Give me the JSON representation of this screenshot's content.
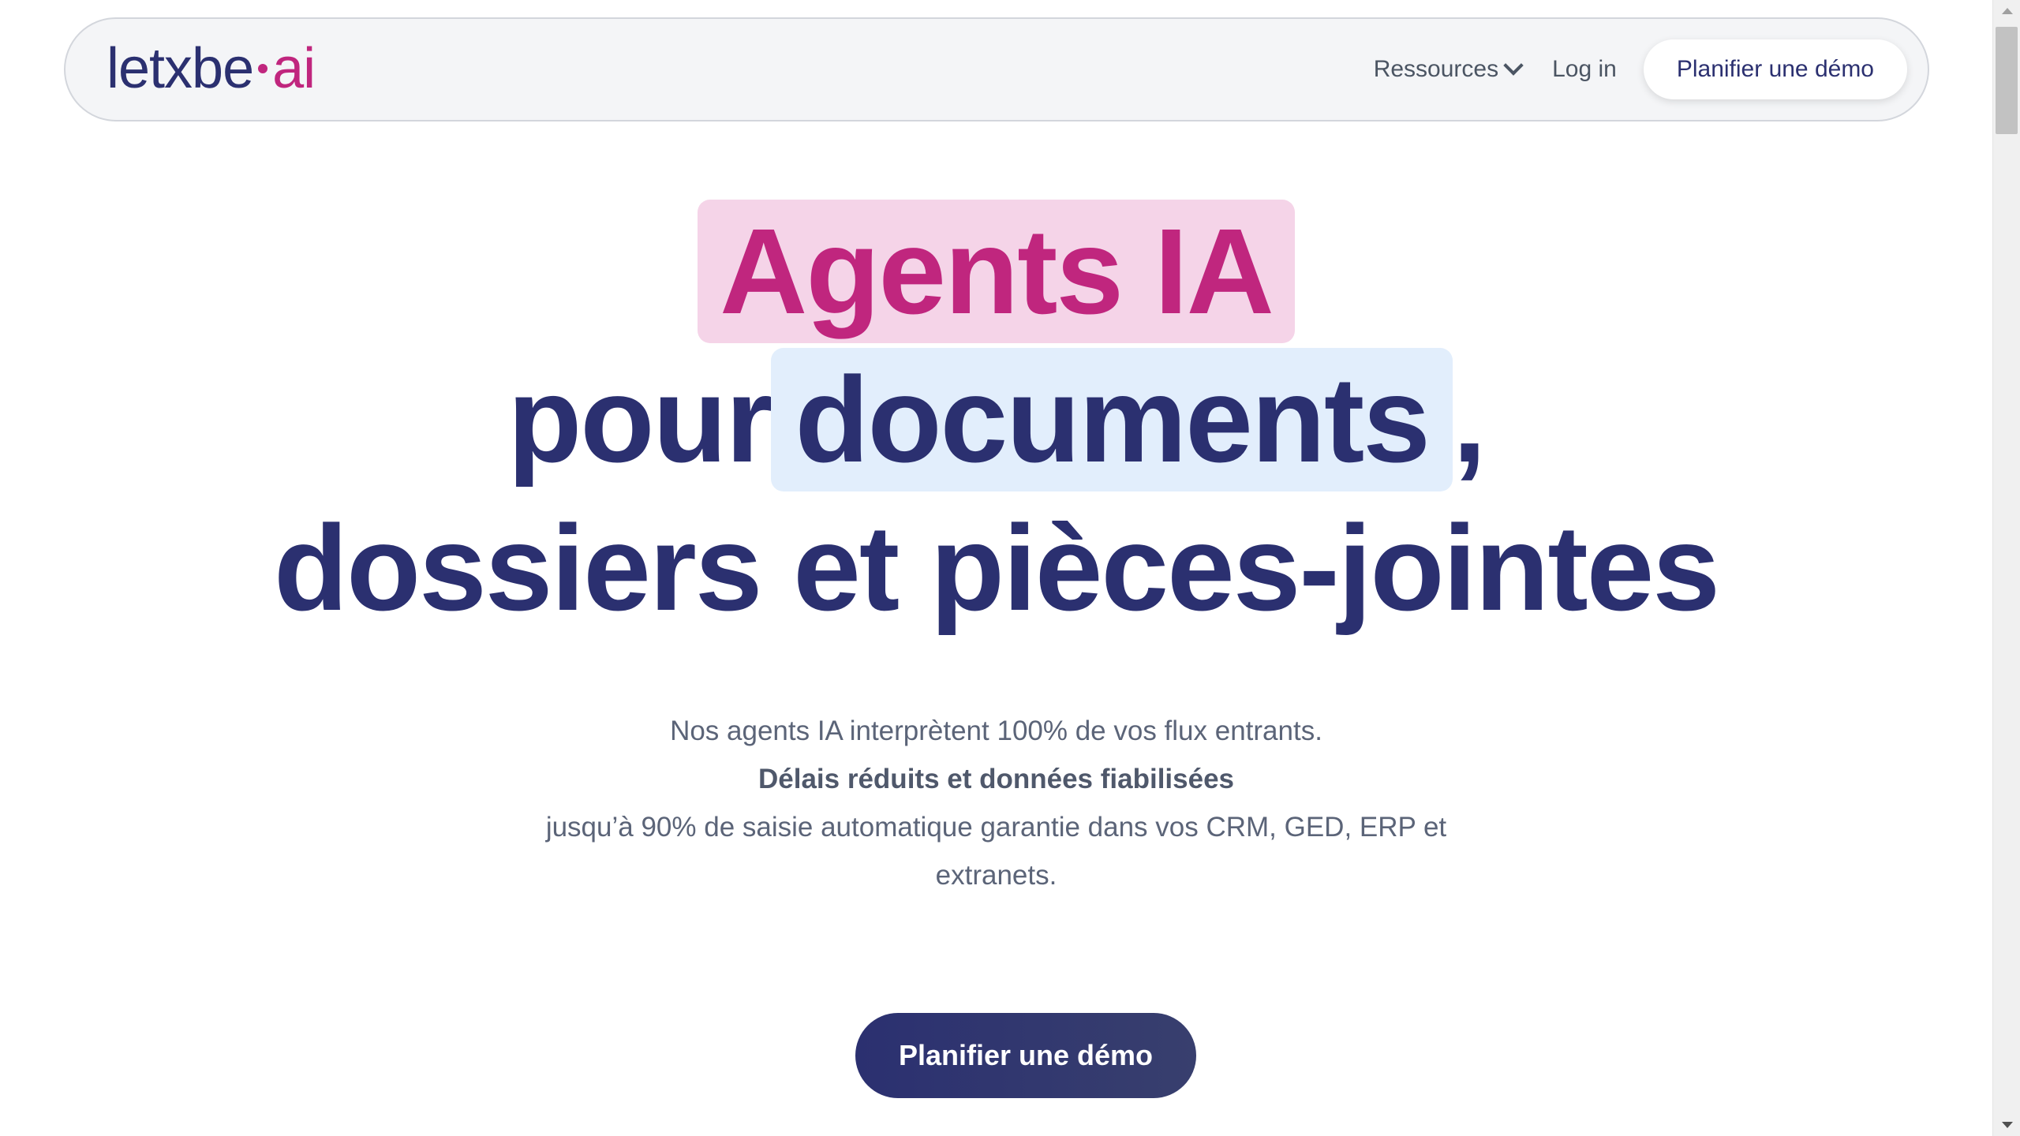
{
  "brand": {
    "logo_main": "letxbe",
    "logo_suffix": "ai",
    "accent_color": "#c0267e",
    "primary_color": "#2b3070"
  },
  "nav": {
    "resources_label": "Ressources",
    "login_label": "Log in",
    "cta_label": "Planifier une démo"
  },
  "hero": {
    "title_line1": "Agents IA",
    "title_line2_prefix": "pour",
    "title_line2_highlight": "documents",
    "title_line2_suffix": ",",
    "title_line3": "dossiers et pièces-jointes",
    "subtitle_line1": "Nos agents IA interprètent 100% de vos flux entrants.",
    "subtitle_line2": "Délais réduits et données fiabilisées",
    "subtitle_line3": "jusqu’à 90% de saisie automatique garantie dans vos CRM, GED, ERP et",
    "subtitle_line4": "extranets.",
    "cta_label": "Planifier une démo"
  }
}
